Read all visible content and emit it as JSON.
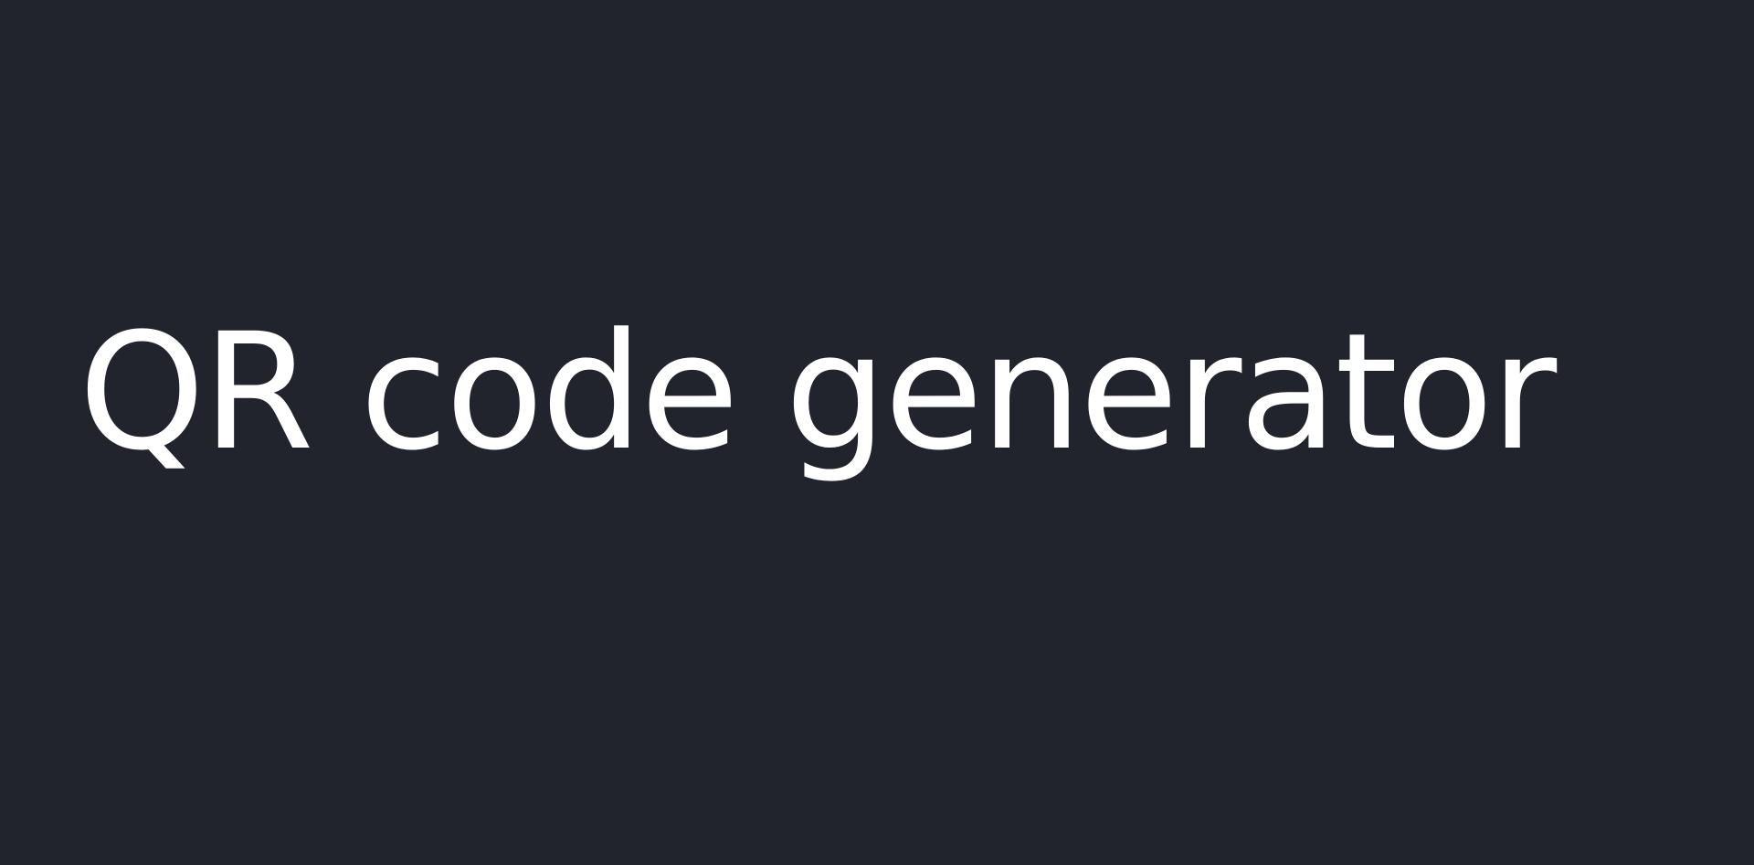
{
  "page": {
    "title": "QR code generator",
    "background_color": "#21242d",
    "text_color": "#ffffff"
  }
}
